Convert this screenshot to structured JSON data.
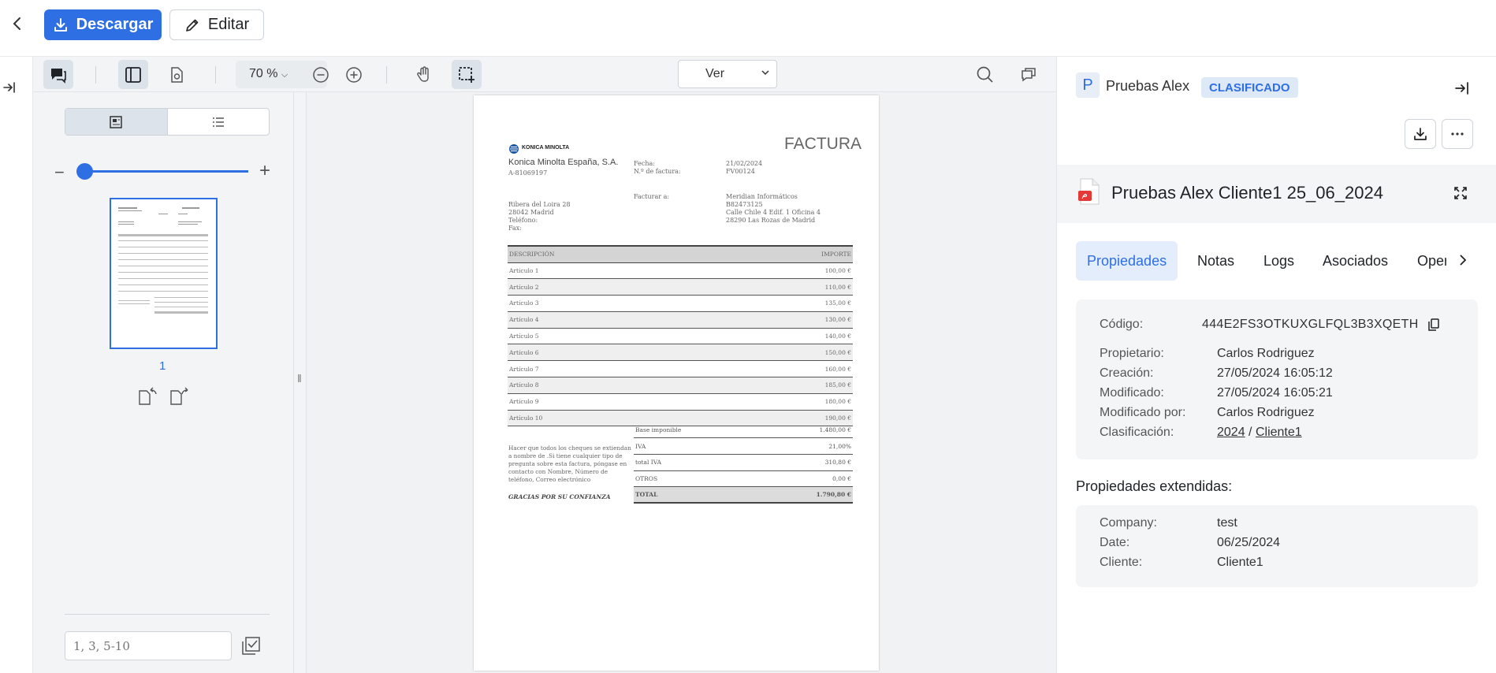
{
  "toolbar": {
    "download_label": "Descargar",
    "edit_label": "Editar",
    "zoom": "70 %",
    "view_select": "Ver"
  },
  "thumbnails": {
    "page_number": "1",
    "page_range_placeholder": "1, 3, 5-10"
  },
  "invoice": {
    "logo_text": "KONICA MINOLTA",
    "title": "FACTURA",
    "company": "Konica Minolta España, S.A.",
    "company_id": "A-81069197",
    "fecha_label": "Fecha:",
    "fecha_value": "21/02/2024",
    "numero_label": "N.º de factura:",
    "numero_value": "FV00124",
    "facturar_label": "Facturar a:",
    "address_lines": [
      "Ribera del Loira 28",
      "28042 Madrid",
      "Teléfono:",
      "Fax:"
    ],
    "bill_to_lines": [
      "Meridian Informáticos",
      "B82473125",
      "Calle Chile 4 Edif. 1 Oficina 4",
      "28290 Las Rozas de Madrid"
    ],
    "col_desc": "DESCRIPCIÓN",
    "col_amount": "IMPORTE",
    "items": [
      {
        "desc": "Artículo 1",
        "amount": "100,00 €"
      },
      {
        "desc": "Artículo 2",
        "amount": "110,00 €"
      },
      {
        "desc": "Artículo 3",
        "amount": "135,00 €"
      },
      {
        "desc": "Artículo 4",
        "amount": "130,00 €"
      },
      {
        "desc": "Artículo 5",
        "amount": "140,00 €"
      },
      {
        "desc": "Artículo 6",
        "amount": "150,00 €"
      },
      {
        "desc": "Artículo 7",
        "amount": "160,00 €"
      },
      {
        "desc": "Artículo 8",
        "amount": "185,00 €"
      },
      {
        "desc": "Artículo 9",
        "amount": "180,00 €"
      },
      {
        "desc": "Artículo 10",
        "amount": "190,00 €"
      }
    ],
    "totals": [
      {
        "label": "Base imponible",
        "value": "1.480,00 €"
      },
      {
        "label": "IVA",
        "value": "21,00%"
      },
      {
        "label": "total IVA",
        "value": "310,80 €"
      },
      {
        "label": "OTROS",
        "value": "0,00 €"
      },
      {
        "label": "TOTAL",
        "value": "1.790,80 €"
      }
    ],
    "note": "Hacer que todos los cheques se extiendan a nombre de .Si tiene cualquier tipo de pregunta sobre esta factura, póngase en contacto con Nombre, Número de teléfono, Correo electrónico",
    "thanks": "GRACIAS POR SU CONFIANZA"
  },
  "panel": {
    "owner_initial": "P",
    "owner_name": "Pruebas Alex",
    "status_badge": "CLASIFICADO",
    "doc_title": "Pruebas Alex Cliente1 25_06_2024",
    "tabs": [
      "Propiedades",
      "Notas",
      "Logs",
      "Asociados",
      "Oper"
    ],
    "codigo_label": "Código:",
    "codigo_value": "444E2FS3OTKUXGLFQL3B3XQETH",
    "propietario_label": "Propietario:",
    "propietario_value": "Carlos Rodriguez",
    "creacion_label": "Creación:",
    "creacion_value": "27/05/2024 16:05:12",
    "modificado_label": "Modificado:",
    "modificado_value": "27/05/2024 16:05:21",
    "modificado_por_label": "Modificado por:",
    "modificado_por_value": "Carlos Rodriguez",
    "clasificacion_label": "Clasificación:",
    "clasificacion_year": "2024",
    "clasificacion_sep": "/",
    "clasificacion_client": "Cliente1",
    "extended_title": "Propiedades extendidas:",
    "company_label": "Company:",
    "company_value": "test",
    "date_label": "Date:",
    "date_value": "06/25/2024",
    "cliente_label": "Cliente:",
    "cliente_value": "Cliente1"
  },
  "colors": {
    "accent": "#2f6fe4",
    "badge_bg": "#dde9f6",
    "panel_bg": "#f4f5f6"
  }
}
